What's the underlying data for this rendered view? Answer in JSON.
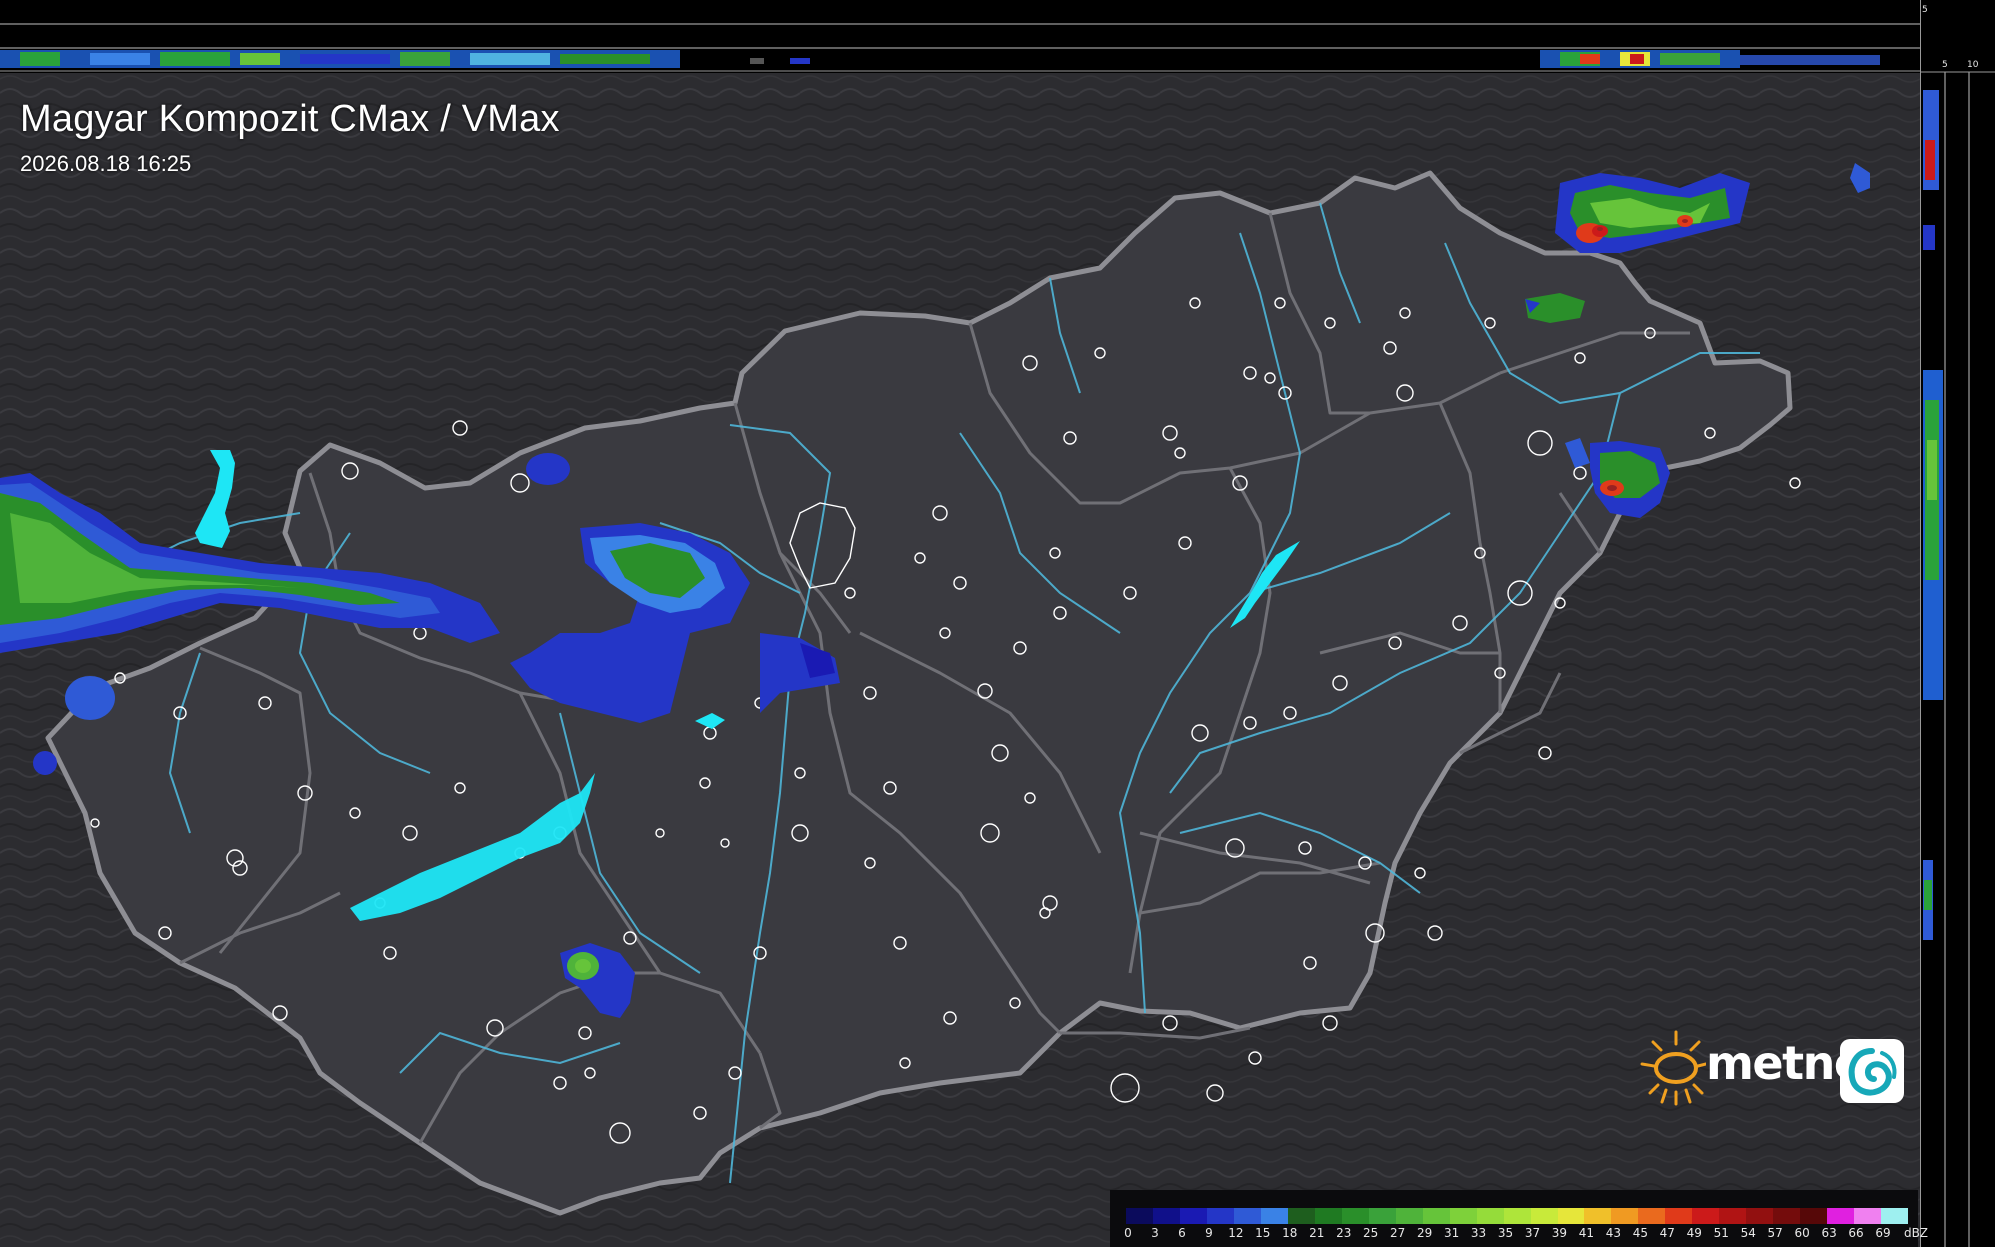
{
  "map": {
    "title": "Magyar Kompozit CMax / VMax",
    "timestamp": "2026.08.18 16:25"
  },
  "profile_scale": {
    "top_strip_ticks": [
      "10",
      "5"
    ],
    "right_strip_ticks": [
      "5",
      "10"
    ]
  },
  "logo": {
    "text": "metnet",
    "sun_icon": "sun-icon",
    "badge_icon": "swirl-icon"
  },
  "legend": {
    "unit": "dBZ",
    "values": [
      "0",
      "3",
      "6",
      "9",
      "12",
      "15",
      "18",
      "21",
      "23",
      "25",
      "27",
      "29",
      "31",
      "33",
      "35",
      "37",
      "39",
      "41",
      "43",
      "45",
      "47",
      "49",
      "51",
      "54",
      "57",
      "60",
      "63",
      "66",
      "69"
    ],
    "colors": [
      "#0b0b5c",
      "#10108a",
      "#1a1ab3",
      "#2436c7",
      "#2f5ad6",
      "#3a82e6",
      "#1e5e1e",
      "#1f7a22",
      "#2a8f2a",
      "#3aa23a",
      "#4fb33a",
      "#66c43a",
      "#7ed13a",
      "#95dc3a",
      "#aee53a",
      "#c8ea3a",
      "#e6e63a",
      "#f0c02a",
      "#f09a22",
      "#ea6a1e",
      "#e03a1a",
      "#cc1a1a",
      "#b01414",
      "#921010",
      "#740c0c",
      "#560808",
      "#e020e0",
      "#f080f0",
      "#9ef0f0"
    ]
  }
}
